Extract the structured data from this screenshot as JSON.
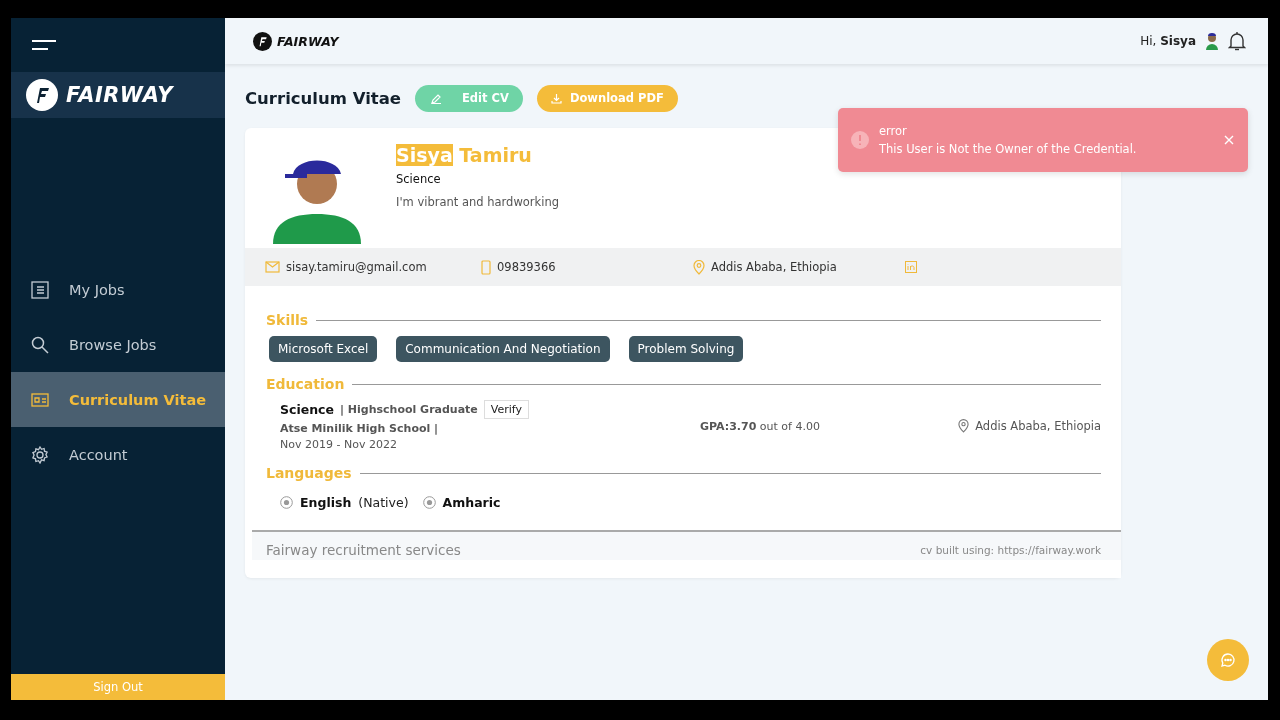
{
  "sidebar": {
    "brand": "FAIRWAY",
    "items": [
      {
        "kind": "jobs",
        "label": "My Jobs",
        "selected": false
      },
      {
        "kind": "browse",
        "label": "Browse Jobs",
        "selected": false
      },
      {
        "kind": "cv",
        "label": "Curriculum Vitae",
        "selected": true
      },
      {
        "kind": "account",
        "label": "Account",
        "selected": false
      }
    ],
    "sign_out": "Sign Out"
  },
  "header": {
    "brand": "FAIRWAY",
    "greeting": "Hi,",
    "user": "Sisya"
  },
  "page": {
    "title": "Curriculum Vitae",
    "buttons": [
      {
        "kind": "edit",
        "label": "Edit CV"
      },
      {
        "kind": "download",
        "label": "Download PDF"
      }
    ]
  },
  "profile": {
    "name_parts": [
      {
        "text": "Sisya",
        "highlighted": true
      },
      {
        "text": "Tamiru",
        "highlighted": false
      }
    ],
    "field": "Science",
    "bio": "I'm vibrant and hardworking"
  },
  "contacts": [
    {
      "kind": "email",
      "text": "sisay.tamiru@gmail.com"
    },
    {
      "kind": "phone",
      "text": "09839366"
    },
    {
      "kind": "location",
      "text": "Addis Ababa, Ethiopia"
    },
    {
      "kind": "linkedin"
    }
  ],
  "skills": {
    "title": "Skills",
    "items": [
      "Microsoft Excel",
      "Communication And Negotiation",
      "Problem Solving"
    ]
  },
  "education": {
    "title": "Education",
    "entries": [
      {
        "field": "Science",
        "level": "| Highschool Graduate",
        "verify": "Verify",
        "school": "Atse Minilik High School |",
        "dates": "Nov 2019 - Nov 2022",
        "gpa": "**GPA:3.70** out of 4.00",
        "location": "Addis Ababa, Ethiopia"
      }
    ]
  },
  "languages": {
    "title": "Languages",
    "items": [
      {
        "name": "English",
        "level": "(Native)"
      },
      {
        "name": "Amharic"
      }
    ]
  },
  "footer": {
    "left": "Fairway recruitment services",
    "right": "cv built using: https://fairway.work"
  },
  "toast": {
    "title": "error",
    "message": "This User is Not the Owner of the Credential."
  }
}
